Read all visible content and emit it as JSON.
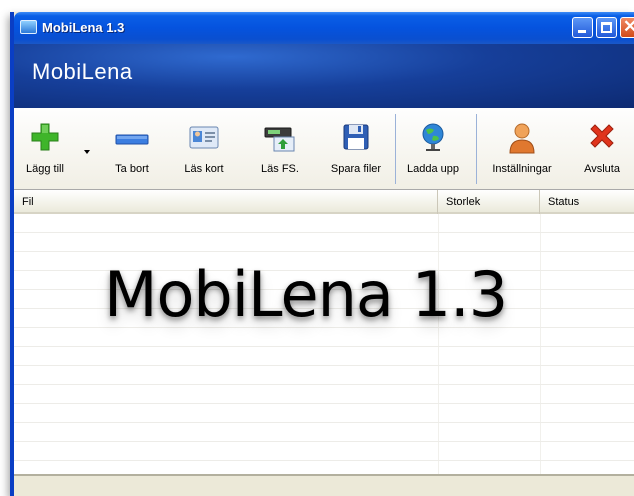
{
  "window": {
    "title": "MobiLena 1.3",
    "controls": {
      "minimize": "minimize",
      "maximize": "maximize",
      "close": "close"
    }
  },
  "banner": {
    "title": "MobiLena"
  },
  "toolbar": {
    "items": [
      {
        "label": "Lägg till",
        "icon": "add-icon"
      },
      {
        "label": "Ta bort",
        "icon": "remove-icon"
      },
      {
        "label": "Läs kort",
        "icon": "id-card-icon"
      },
      {
        "label": "Läs FS.",
        "icon": "device-icon"
      },
      {
        "label": "Spara filer",
        "icon": "floppy-disk-icon"
      },
      {
        "label": "Ladda upp",
        "icon": "globe-upload-icon"
      },
      {
        "label": "Inställningar",
        "icon": "user-settings-icon"
      },
      {
        "label": "Avsluta",
        "icon": "exit-x-icon"
      }
    ]
  },
  "file_list": {
    "columns": [
      "Fil",
      "Storlek",
      "Status"
    ],
    "rows": []
  },
  "overlay": {
    "text": "MobiLena 1.3"
  },
  "colors": {
    "titlebar": "#0553de",
    "banner": "#163f9a",
    "add_green": "#3fb52a",
    "remove_blue": "#3b7de0",
    "exit_red": "#e0341c"
  }
}
